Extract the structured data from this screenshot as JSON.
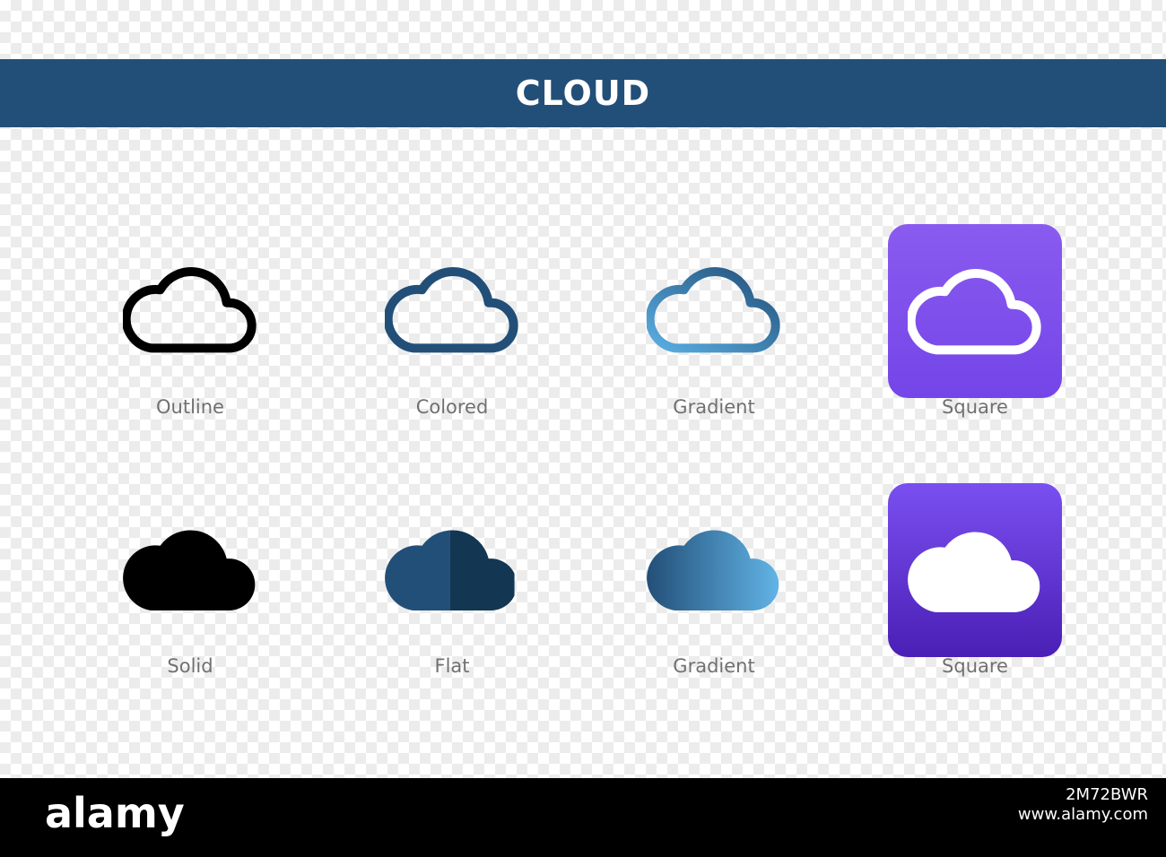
{
  "header": {
    "title": "CLOUD",
    "color": "#224f78"
  },
  "icons": [
    {
      "label": "Outline",
      "style": "outline",
      "icon": "cloud-outline-icon",
      "color": "#000000"
    },
    {
      "label": "Colored",
      "style": "colored",
      "icon": "cloud-colored-icon",
      "color": "#224f78"
    },
    {
      "label": "Gradient",
      "style": "gradient-outline",
      "icon": "cloud-gradient-outline-icon",
      "color": "#5aaee2"
    },
    {
      "label": "Square",
      "style": "square-outline",
      "icon": "cloud-square-outline-icon",
      "color": "#7a4fea"
    },
    {
      "label": "Solid",
      "style": "solid",
      "icon": "cloud-solid-icon",
      "color": "#000000"
    },
    {
      "label": "Flat",
      "style": "flat",
      "icon": "cloud-flat-icon",
      "color": "#224f78"
    },
    {
      "label": "Gradient",
      "style": "gradient-solid",
      "icon": "cloud-gradient-solid-icon",
      "color": "#5aaee2"
    },
    {
      "label": "Square",
      "style": "square-solid",
      "icon": "cloud-square-solid-icon",
      "color": "#5a2fd0"
    }
  ],
  "footer": {
    "logo": "alamy",
    "image_id": "2M72BWR",
    "image_url": "www.alamy.com"
  }
}
